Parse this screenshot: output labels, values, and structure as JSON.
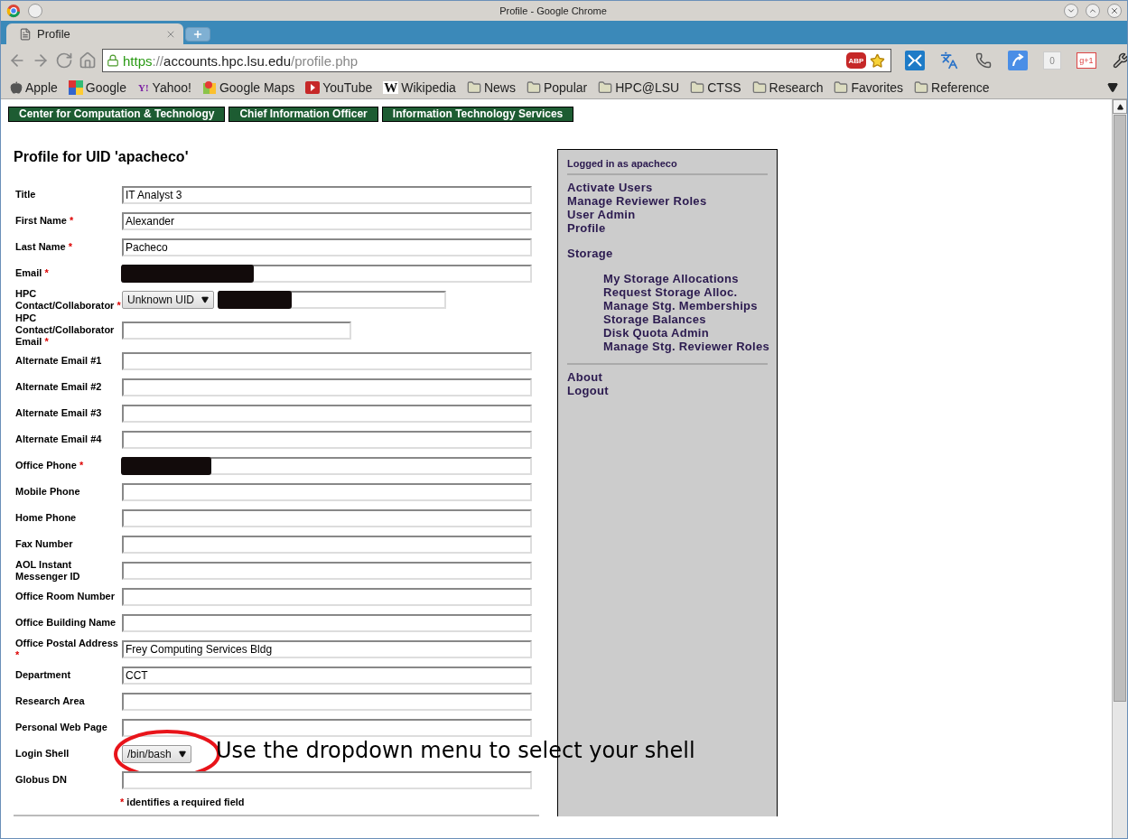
{
  "window": {
    "title": "Profile - Google Chrome"
  },
  "tabs": [
    {
      "label": "Profile",
      "selected": true
    }
  ],
  "address": {
    "scheme": "https",
    "separator": "://",
    "host": "accounts.hpc.lsu.edu",
    "path": "/profile.php",
    "secure": true
  },
  "address_badges": [
    {
      "kind": "adblock",
      "label": "ABP"
    },
    {
      "kind": "star"
    }
  ],
  "extensions": [
    {
      "kind": "arrows"
    },
    {
      "kind": "translate"
    },
    {
      "kind": "phone"
    },
    {
      "kind": "share"
    },
    {
      "kind": "counter",
      "label": "0"
    },
    {
      "kind": "plusone",
      "label": "g+1"
    },
    {
      "kind": "wrench"
    }
  ],
  "bookmarks": [
    {
      "label": "Apple",
      "kind": "apple"
    },
    {
      "label": "Google",
      "kind": "google"
    },
    {
      "label": "Yahoo!",
      "kind": "yahoo",
      "glyph": "Y!"
    },
    {
      "label": "Google Maps",
      "kind": "maps"
    },
    {
      "label": "YouTube",
      "kind": "youtube"
    },
    {
      "label": "Wikipedia",
      "kind": "wiki",
      "glyph": "W"
    },
    {
      "label": "News",
      "kind": "folder"
    },
    {
      "label": "Popular",
      "kind": "folder"
    },
    {
      "label": "HPC@LSU",
      "kind": "folder"
    },
    {
      "label": "CTSS",
      "kind": "folder"
    },
    {
      "label": "Research",
      "kind": "folder"
    },
    {
      "label": "Favorites",
      "kind": "folder"
    },
    {
      "label": "Reference",
      "kind": "folder"
    }
  ],
  "nav_links": [
    "Center for Computation & Technology",
    "Chief Information Officer",
    "Information Technology Services"
  ],
  "heading": "Profile for UID 'apacheco'",
  "required_marker": "*",
  "fields": [
    {
      "label": "Title",
      "required": false,
      "kind": "text",
      "value": "IT Analyst 3"
    },
    {
      "label": "First Name",
      "required": true,
      "kind": "text",
      "value": "Alexander"
    },
    {
      "label": "Last Name",
      "required": true,
      "kind": "text",
      "value": "Pacheco"
    },
    {
      "label": "Email",
      "required": true,
      "kind": "text",
      "redacted": true
    },
    {
      "label": "HPC Contact/Collaborator",
      "required": true,
      "kind": "select_text",
      "select_value": "Unknown UID",
      "redacted": true
    },
    {
      "label": "HPC Contact/Collaborator Email",
      "required": true,
      "kind": "short_text"
    },
    {
      "label": "Alternate Email #1",
      "required": false,
      "kind": "text"
    },
    {
      "label": "Alternate Email #2",
      "required": false,
      "kind": "text"
    },
    {
      "label": "Alternate Email #3",
      "required": false,
      "kind": "text"
    },
    {
      "label": "Alternate Email #4",
      "required": false,
      "kind": "text"
    },
    {
      "label": "Office Phone",
      "required": true,
      "kind": "text",
      "redacted": true
    },
    {
      "label": "Mobile Phone",
      "required": false,
      "kind": "text"
    },
    {
      "label": "Home Phone",
      "required": false,
      "kind": "text"
    },
    {
      "label": "Fax Number",
      "required": false,
      "kind": "text"
    },
    {
      "label": "AOL Instant Messenger ID",
      "required": false,
      "kind": "text"
    },
    {
      "label": "Office Room Number",
      "required": false,
      "kind": "text"
    },
    {
      "label": "Office Building Name",
      "required": false,
      "kind": "text"
    },
    {
      "label": "Office Postal Address",
      "required": true,
      "kind": "text",
      "value": "Frey Computing Services Bldg"
    },
    {
      "label": "Department",
      "required": false,
      "kind": "text",
      "value": "CCT"
    },
    {
      "label": "Research Area",
      "required": false,
      "kind": "text"
    },
    {
      "label": "Personal Web Page",
      "required": false,
      "kind": "text"
    },
    {
      "label": "Login Shell",
      "required": false,
      "kind": "select",
      "select_value": "/bin/bash",
      "annotated": true
    },
    {
      "label": "Globus DN",
      "required": false,
      "kind": "text"
    }
  ],
  "required_note": "identifies a required field",
  "annotation": "Use the dropdown menu to select your shell",
  "sidebar": {
    "logged_in": "Logged in as apacheco",
    "admin_links": [
      "Activate Users",
      "Manage Reviewer Roles",
      "User Admin",
      "Profile"
    ],
    "storage_heading": "Storage",
    "storage_links": [
      "My Storage Allocations",
      "Request Storage Alloc.",
      "Manage Stg. Memberships",
      "Storage Balances",
      "Disk Quota Admin",
      "Manage Stg. Reviewer Roles"
    ],
    "footer_links": [
      "About",
      "Logout"
    ]
  }
}
